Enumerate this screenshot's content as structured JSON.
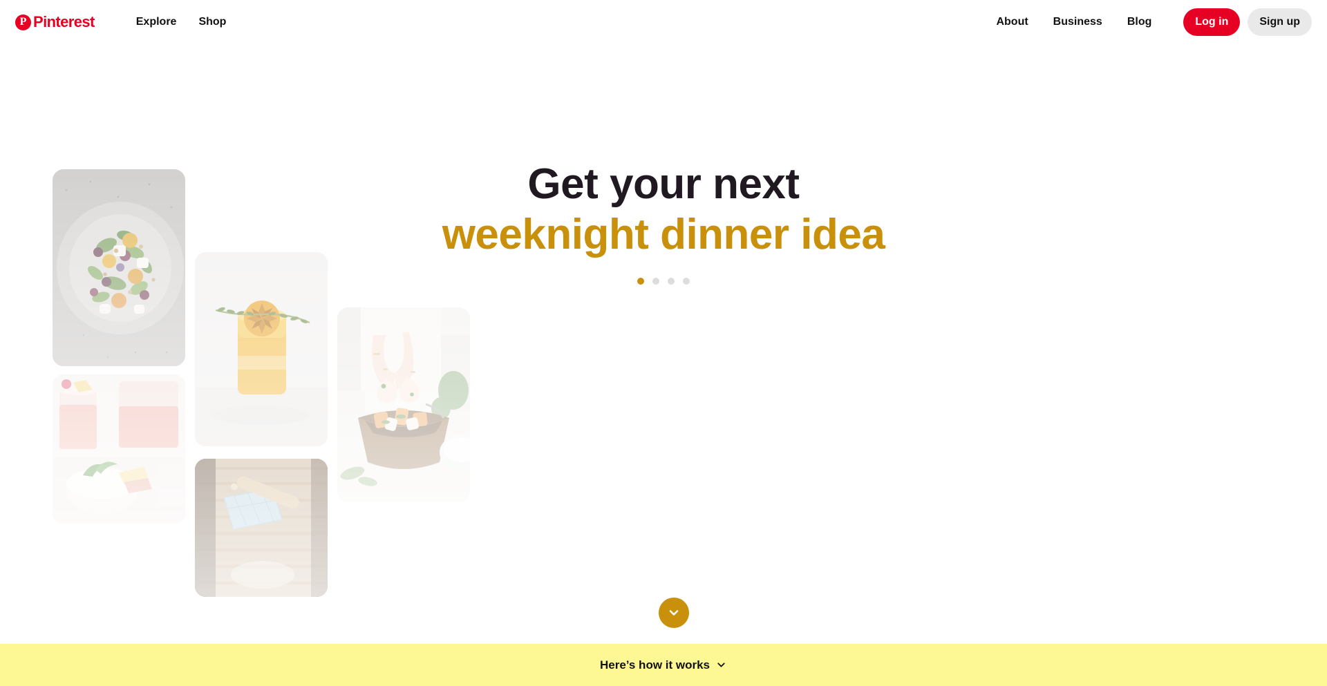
{
  "header": {
    "logo": {
      "icon": "pinterest-logo-icon",
      "word": "Pinterest",
      "mark": "P"
    },
    "left_links": [
      {
        "label": "Explore"
      },
      {
        "label": "Shop"
      }
    ],
    "right_links": [
      {
        "label": "About"
      },
      {
        "label": "Business"
      },
      {
        "label": "Blog"
      }
    ],
    "login_label": "Log in",
    "signup_label": "Sign up"
  },
  "hero": {
    "headline_line1": "Get your next",
    "headline_line2": "weeknight dinner idea",
    "headline_line1_color": "#211922",
    "headline_line2_color": "#c8900b",
    "carousel": {
      "count": 4,
      "active_index": 0,
      "active_color": "#c8900b",
      "inactive_color": "#dedcdc"
    },
    "scroll_button": {
      "icon": "chevron-down-icon",
      "color": "#c8900b"
    }
  },
  "collage": {
    "images": [
      {
        "name": "beet-salad-plate",
        "alt": "Beet and goat cheese salad on a gray plate"
      },
      {
        "name": "pink-lemonade-drinks",
        "alt": "Pink lemonade drinks with mint and lemon slices"
      },
      {
        "name": "orange-cocktail-thyme",
        "alt": "Orange cocktail garnished with grilled orange and thyme"
      },
      {
        "name": "rolling-pin-potholder",
        "alt": "Rolling pin and blue pot holder on a wooden table"
      },
      {
        "name": "hands-wooden-bowl",
        "alt": "Hands garnishing a wooden bowl of roasted squash"
      }
    ]
  },
  "bottom_bar": {
    "label": "Here’s how it works",
    "icon": "chevron-down-icon",
    "background_color": "#fdf894"
  }
}
